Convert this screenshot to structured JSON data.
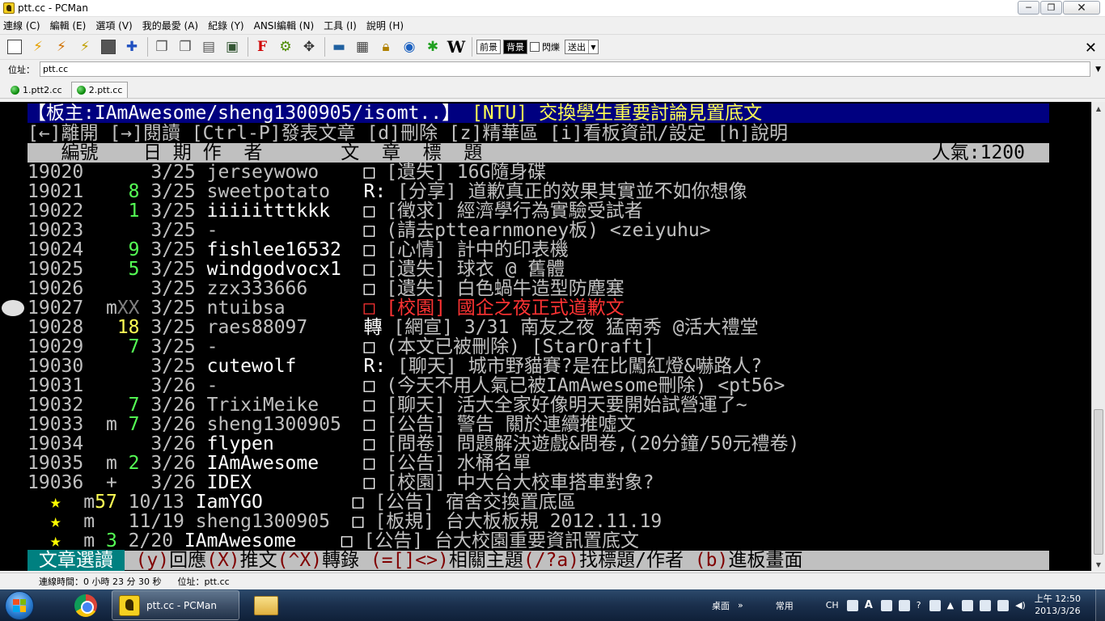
{
  "window": {
    "title": "ptt.cc - PCMan",
    "minimize": "─",
    "maximize": "❐",
    "close": "✕"
  },
  "menu": [
    "連線 (C)",
    "編輯 (E)",
    "選項 (V)",
    "我的最愛 (A)",
    "紀錄 (Y)",
    "ANSI編輯 (N)",
    "工具 (I)",
    "說明 (H)"
  ],
  "toolbar": {
    "fg_label": "前景",
    "bg_label": "背景",
    "blink_label": "閃爍",
    "send_label": "送出",
    "wiki_label": "W",
    "close": "✕"
  },
  "address": {
    "label": "位址：",
    "value": "ptt.cc"
  },
  "tabs": [
    {
      "label": "1.ptt2.cc",
      "active": false
    },
    {
      "label": "2.ptt.cc",
      "active": true
    }
  ],
  "terminal": {
    "header_prefix": "【板主:",
    "header_mods": "IAmAwesome/sheng1300905/isomt..",
    "header_suffix": "】",
    "header_board": "[NTU]",
    "header_title": " 交換學生重要討論見置底文",
    "help_line": "[←]離開 [→]閱讀 [Ctrl-P]發表文章 [d]刪除 [z]精華區 [i]看板資訊/設定 [h]說明",
    "col_header": "   編號    日 期 作  者       文  章  標  題",
    "popularity": "人氣:1200",
    "rows": [
      {
        "num": "19020",
        "mark": " ",
        "push": "  ",
        "push_color": "gr",
        "date": "3/25",
        "author": "jerseywowo",
        "author_color": "g",
        "type": "□",
        "title": "[遺失] 16G隨身碟",
        "title_color": "g"
      },
      {
        "num": "19021",
        "mark": " ",
        "push": " 8",
        "push_color": "gr",
        "date": "3/25",
        "author": "sweetpotato",
        "author_color": "g",
        "type": "R:",
        "title": "[分享] 道歉真正的效果其實並不如你想像",
        "title_color": "g"
      },
      {
        "num": "19022",
        "mark": " ",
        "push": " 1",
        "push_color": "gr",
        "date": "3/25",
        "author": "iiiiitttkkk",
        "author_color": "w",
        "type": "□",
        "title": "[徵求] 經濟學行為實驗受試者",
        "title_color": "g"
      },
      {
        "num": "19023",
        "mark": " ",
        "push": "  ",
        "push_color": "gr",
        "date": "3/25",
        "author": "-",
        "author_color": "g",
        "type": "□",
        "title": "(請去pttearnmoney板) <zeiyuhu>",
        "title_color": "g"
      },
      {
        "num": "19024",
        "mark": " ",
        "push": " 9",
        "push_color": "gr",
        "date": "3/25",
        "author": "fishlee16532",
        "author_color": "w",
        "type": "□",
        "title": "[心情] 計中的印表機",
        "title_color": "g"
      },
      {
        "num": "19025",
        "mark": " ",
        "push": " 5",
        "push_color": "gr",
        "date": "3/25",
        "author": "windgodvocx1",
        "author_color": "w",
        "type": "□",
        "title": "[遺失] 球衣 @ 舊體",
        "title_color": "g"
      },
      {
        "num": "19026",
        "mark": " ",
        "push": "  ",
        "push_color": "gr",
        "date": "3/25",
        "author": "zzx333666",
        "author_color": "g",
        "type": "□",
        "title": "[遺失] 白色蝸牛造型防塵塞",
        "title_color": "g"
      },
      {
        "num": "19027",
        "mark": "m",
        "push": "XX",
        "push_color": "dg",
        "date": "3/25",
        "author": "ntuibsa",
        "author_color": "g",
        "type": "□",
        "title": "[校園] 國企之夜正式道歉文",
        "title_color": "rd",
        "type_color": "rd"
      },
      {
        "num": "19028",
        "mark": " ",
        "push": "18",
        "push_color": "ye",
        "date": "3/25",
        "author": "raes88097",
        "author_color": "g",
        "type": "轉",
        "title": "[網宣] 3/31 南友之夜 猛南秀 @活大禮堂",
        "title_color": "g"
      },
      {
        "num": "19029",
        "mark": " ",
        "push": " 7",
        "push_color": "gr",
        "date": "3/25",
        "author": "-",
        "author_color": "g",
        "type": "□",
        "title": "(本文已被刪除) [StarOraft]",
        "title_color": "g"
      },
      {
        "num": "19030",
        "mark": " ",
        "push": "  ",
        "push_color": "gr",
        "date": "3/25",
        "author": "cutewolf",
        "author_color": "w",
        "type": "R:",
        "title": "[聊天] 城市野貓賽?是在比闖紅燈&嚇路人?",
        "title_color": "g"
      },
      {
        "num": "19031",
        "mark": " ",
        "push": "  ",
        "push_color": "gr",
        "date": "3/26",
        "author": "-",
        "author_color": "g",
        "type": "□",
        "title": "(今天不用人氣已被IAmAwesome刪除) <pt56>",
        "title_color": "g"
      },
      {
        "num": "19032",
        "mark": " ",
        "push": " 7",
        "push_color": "gr",
        "date": "3/26",
        "author": "TrixiMeike",
        "author_color": "g",
        "type": "□",
        "title": "[聊天] 活大全家好像明天要開始試營運了~",
        "title_color": "g"
      },
      {
        "num": "19033",
        "mark": "m",
        "push": " 7",
        "push_color": "gr",
        "date": "3/26",
        "author": "sheng1300905",
        "author_color": "g",
        "type": "□",
        "title": "[公告] 警告 關於連續推噓文",
        "title_color": "g"
      },
      {
        "num": "19034",
        "mark": " ",
        "push": "  ",
        "push_color": "gr",
        "date": "3/26",
        "author": "flypen",
        "author_color": "w",
        "type": "□",
        "title": "[問卷] 問題解決遊戲&問卷,(20分鐘/50元禮卷)",
        "title_color": "g"
      },
      {
        "num": "19035",
        "mark": "m",
        "push": " 2",
        "push_color": "gr",
        "date": "3/26",
        "author": "IAmAwesome",
        "author_color": "w",
        "type": "□",
        "title": "[公告] 水桶名單",
        "title_color": "g"
      },
      {
        "num": "19036",
        "mark": "+",
        "push": "  ",
        "push_color": "gr",
        "date": "3/26",
        "author": "IDEX",
        "author_color": "w",
        "type": "□",
        "title": "[校園] 中大台大校車搭車對象?",
        "title_color": "g"
      },
      {
        "num": "  ★",
        "mark": "m",
        "push": "57",
        "push_color": "ye",
        "date": "10/13",
        "author": "IamYGO",
        "author_color": "w",
        "type": "□",
        "title": "[公告] 宿舍交換置底區",
        "title_color": "g"
      },
      {
        "num": "  ★",
        "mark": "m",
        "push": "  ",
        "push_color": "gr",
        "date": "11/19",
        "author": "sheng1300905",
        "author_color": "g",
        "type": "□",
        "title": "[板規] 台大板板規 2012.11.19",
        "title_color": "g"
      },
      {
        "num": "  ★",
        "mark": "m",
        "push": " 3",
        "push_color": "gr",
        "date": "2/20",
        "author": "IAmAwesome",
        "author_color": "w",
        "type": "□",
        "title": "[公告] 台大校園重要資訊置底文",
        "title_color": "g"
      }
    ],
    "footer_title": " 文章選讀 ",
    "footer_parts": [
      {
        "key": "(y)",
        "text": "回應"
      },
      {
        "key": "(X)",
        "text": "推文"
      },
      {
        "key": "(^X)",
        "text": "轉錄 "
      },
      {
        "key": "(=[]<>)",
        "text": "相關主題"
      },
      {
        "key": "(/?a)",
        "text": "找標題/作者 "
      },
      {
        "key": "(b)",
        "text": "進板畫面"
      }
    ]
  },
  "status": {
    "connection_time": "連線時間：0 小時 23 分 30 秒",
    "address": "位址：ptt.cc"
  },
  "taskbar": {
    "app_label": "ptt.cc - PCMan",
    "tray_desktop": "桌面",
    "tray_common": "常用",
    "tray_lang": "CH",
    "time": "上午 12:50",
    "date": "2013/3/26"
  }
}
